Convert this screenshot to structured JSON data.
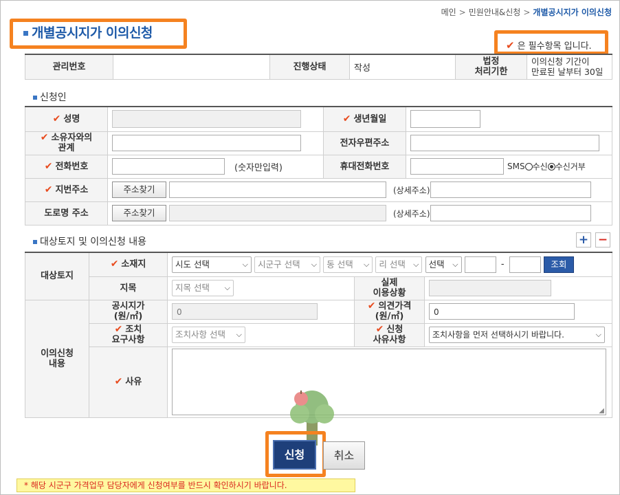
{
  "breadcrumb": {
    "home": "메인",
    "section": "민원안내&신청",
    "current": "개별공시지가 이의신청",
    "sep": ">"
  },
  "page_title": "개별공시지가 이의신청",
  "required_note": "은 필수항목 입니다.",
  "summary": {
    "mgmt_no_label": "관리번호",
    "mgmt_no_value": "",
    "status_label": "진행상태",
    "status_value": "작성",
    "deadline_label_1": "법정",
    "deadline_label_2": "처리기한",
    "deadline_value_1": "이의신청 기간이",
    "deadline_value_2": "만료된 날부터 30일"
  },
  "applicant": {
    "section_title": "신청인",
    "name_label": "성명",
    "birth_label": "생년월일",
    "relation_label_1": "소유자와의",
    "relation_label_2": "관계",
    "email_label": "전자우편주소",
    "phone_label": "전화번호",
    "phone_hint": "(숫자만입력)",
    "mobile_label": "휴대전화번호",
    "sms_label": "SMS",
    "sms_opt_in": "수신",
    "sms_opt_out": "수신거부",
    "lot_addr_label": "지번주소",
    "road_addr_label": "도로명 주소",
    "find_addr_btn": "주소찾기",
    "detail_addr_label": "(상세주소)"
  },
  "target": {
    "section_title": "대상토지 및 이의신청 내용",
    "plus": "+",
    "minus": "−",
    "target_land_label": "대상토지",
    "location_label": "소재지",
    "sido_select": "시도 선택",
    "sigungu_select": "시군구 선택",
    "dong_select": "동 선택",
    "ri_select": "리 선택",
    "type_select": "선택",
    "dash": "-",
    "lookup_btn": "조회",
    "jimok_label": "지목",
    "jimok_select": "지목 선택",
    "actual_use_label_1": "실제",
    "actual_use_label_2": "이용상황",
    "objection_label_1": "이의신청",
    "objection_label_2": "내용",
    "price_label_1": "공시지가",
    "price_label_2": "(원/㎡)",
    "price_value": "0",
    "opinion_label_1": "의견가격",
    "opinion_label_2": "(원/㎡)",
    "opinion_value": "0",
    "action_label_1": "조치",
    "action_label_2": "요구사항",
    "action_select": "조치사항 선택",
    "reason_cat_label_1": "신청",
    "reason_cat_label_2": "사유사항",
    "reason_cat_select": "조치사항을 먼저 선택하시기 바랍니다.",
    "reason_label": "사유"
  },
  "buttons": {
    "submit": "신청",
    "cancel": "취소"
  },
  "footer_note": "* 해당 시군구 가격업무 담당자에게 신청여부를 반드시 확인하시기 바랍니다.",
  "icons": {
    "required": "checkmark-icon",
    "dropdown": "chevron-down-icon",
    "mascot": "tree-mascot-icon"
  },
  "colors": {
    "accent": "#1e5aa8",
    "highlight": "#f58220",
    "required": "#e84b1e",
    "primary_button": "#1e3f7a"
  }
}
